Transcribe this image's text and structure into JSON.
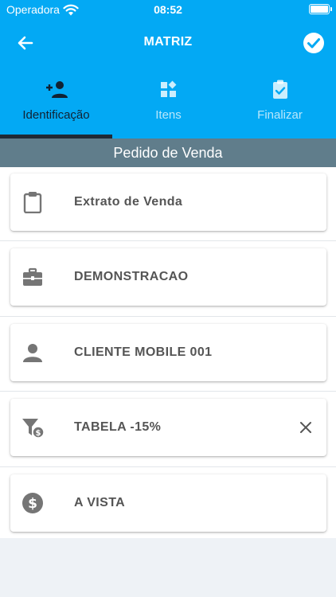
{
  "status_bar": {
    "carrier": "Operadora",
    "time": "08:52"
  },
  "header": {
    "title": "MATRIZ",
    "back_icon": "arrow-left-icon",
    "confirm_icon": "check-circle-icon"
  },
  "tabs": [
    {
      "label": "Identificação",
      "icon": "person-add-icon",
      "active": true
    },
    {
      "label": "Itens",
      "icon": "widgets-icon",
      "active": false
    },
    {
      "label": "Finalizar",
      "icon": "assignment-check-icon",
      "active": false
    }
  ],
  "section": {
    "title": "Pedido de Venda"
  },
  "fields": [
    {
      "label": "Extrato de Venda",
      "icon": "clipboard-icon"
    },
    {
      "label": "DEMONSTRACAO",
      "icon": "briefcase-icon"
    },
    {
      "label": "CLIENTE MOBILE 001",
      "icon": "person-icon"
    },
    {
      "label": "TABELA -15%",
      "icon": "price-filter-icon",
      "clear_icon": "close-icon"
    },
    {
      "label": "A VISTA",
      "icon": "dollar-circle-icon"
    }
  ],
  "colors": {
    "primary": "#03a9f4",
    "section_bar": "#607d8b",
    "tab_underline": "#1f2a36",
    "icon_gray": "#757575"
  }
}
